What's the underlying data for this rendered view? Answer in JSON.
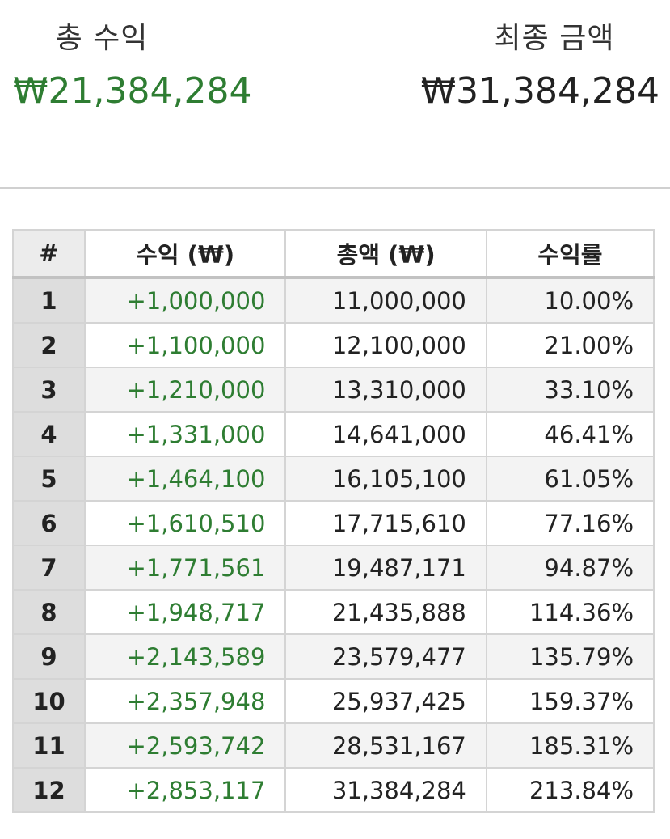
{
  "summary": {
    "total_profit_label": "총 수익",
    "total_profit_value": "₩21,384,284",
    "final_amount_label": "최종 금액",
    "final_amount_value": "₩31,384,284"
  },
  "colors": {
    "profit_green": "#2e7d32",
    "text_dark": "#222222",
    "index_cell_bg": "#dddddd",
    "striped_row_bg": "#f3f3f3",
    "border_gray": "#d4d4d4"
  },
  "table": {
    "headers": {
      "index": "#",
      "profit": "수익 (₩)",
      "total": "총액 (₩)",
      "rate": "수익률"
    },
    "rows": [
      {
        "index": "1",
        "profit": "+1,000,000",
        "total": "11,000,000",
        "rate": "10.00%"
      },
      {
        "index": "2",
        "profit": "+1,100,000",
        "total": "12,100,000",
        "rate": "21.00%"
      },
      {
        "index": "3",
        "profit": "+1,210,000",
        "total": "13,310,000",
        "rate": "33.10%"
      },
      {
        "index": "4",
        "profit": "+1,331,000",
        "total": "14,641,000",
        "rate": "46.41%"
      },
      {
        "index": "5",
        "profit": "+1,464,100",
        "total": "16,105,100",
        "rate": "61.05%"
      },
      {
        "index": "6",
        "profit": "+1,610,510",
        "total": "17,715,610",
        "rate": "77.16%"
      },
      {
        "index": "7",
        "profit": "+1,771,561",
        "total": "19,487,171",
        "rate": "94.87%"
      },
      {
        "index": "8",
        "profit": "+1,948,717",
        "total": "21,435,888",
        "rate": "114.36%"
      },
      {
        "index": "9",
        "profit": "+2,143,589",
        "total": "23,579,477",
        "rate": "135.79%"
      },
      {
        "index": "10",
        "profit": "+2,357,948",
        "total": "25,937,425",
        "rate": "159.37%"
      },
      {
        "index": "11",
        "profit": "+2,593,742",
        "total": "28,531,167",
        "rate": "185.31%"
      },
      {
        "index": "12",
        "profit": "+2,853,117",
        "total": "31,384,284",
        "rate": "213.84%"
      }
    ]
  }
}
